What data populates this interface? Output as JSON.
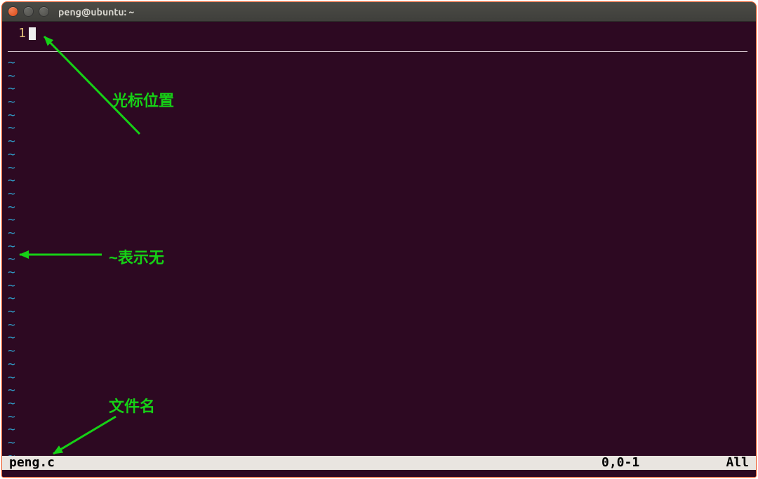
{
  "titlebar": {
    "title": "peng@ubuntu: ~"
  },
  "editor": {
    "line_number": "1",
    "tilde": "~",
    "tilde_rows": 31
  },
  "status": {
    "filename": "peng.c",
    "position": "0,0-1",
    "scroll": "All"
  },
  "annotations": {
    "cursor_label": "光标位置",
    "tilde_label": "~表示无",
    "filename_label": "文件名"
  },
  "colors": {
    "term_bg": "#2d0922",
    "arrow": "#16d016",
    "line_number": "#e2c07a",
    "tilde": "#2f98c2"
  }
}
